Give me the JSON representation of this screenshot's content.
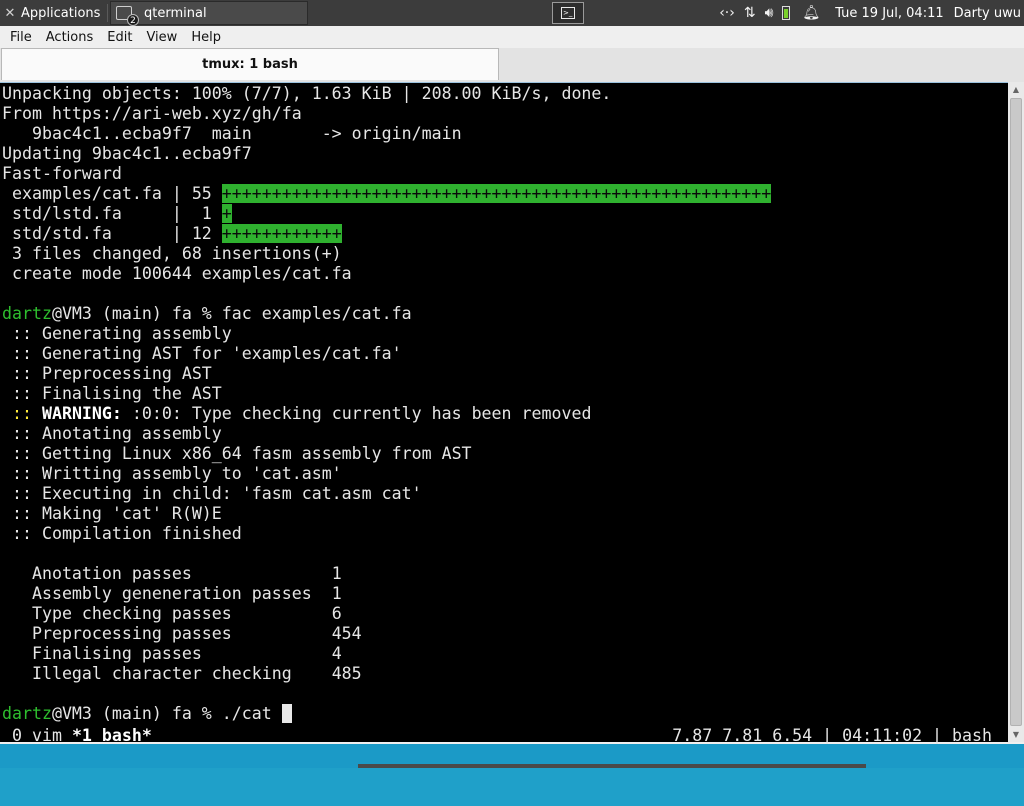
{
  "panel": {
    "applications": "Applications",
    "task_title": "qterminal",
    "task_count": "2",
    "clock": "Tue 19 Jul, 04:11",
    "user": "Darty uwu"
  },
  "menubar": {
    "file": "File",
    "actions": "Actions",
    "edit": "Edit",
    "view": "View",
    "help": "Help"
  },
  "tab": {
    "title": "tmux: 1 bash"
  },
  "terminal": {
    "l01": "Unpacking objects: 100% (7/7), 1.63 KiB | 208.00 KiB/s, done.",
    "l02": "From https://ari-web.xyz/gh/fa",
    "l03": "   9bac4c1..ecba9f7  main       -> origin/main",
    "l04": "Updating 9bac4c1..ecba9f7",
    "l05": "Fast-forward",
    "diff1_name": " examples/cat.fa | 55 ",
    "diff1_bar": "+++++++++++++++++++++++++++++++++++++++++++++++++++++++",
    "diff2_name": " std/lstd.fa     |  1 ",
    "diff2_bar": "+",
    "diff3_name": " std/std.fa      | 12 ",
    "diff3_bar": "++++++++++++",
    "l09": " 3 files changed, 68 insertions(+)",
    "l10": " create mode 100644 examples/cat.fa",
    "prompt_user": "dartz",
    "prompt1_rest": "@VM3 (main) fa % fac examples/cat.fa",
    "s1": " :: Generating assembly",
    "s2": " :: Generating AST for 'examples/cat.fa'",
    "s3": " :: Preprocessing AST",
    "s4": " :: Finalising the AST",
    "warn_prefix": " :: ",
    "warn_label": "WARNING:",
    "warn_text": " :0:0: Type checking currently has been removed",
    "s6": " :: Anotating assembly",
    "s7": " :: Getting Linux x86_64 fasm assembly from AST",
    "s8": " :: Writting assembly to 'cat.asm'",
    "s9": " :: Executing in child: 'fasm cat.asm cat'",
    "s10": " :: Making 'cat' R(W)E",
    "s11": " :: Compilation finished",
    "stats": [
      {
        "label": "   Anotation passes              ",
        "value": "1"
      },
      {
        "label": "   Assembly geneneration passes  ",
        "value": "1"
      },
      {
        "label": "   Type checking passes          ",
        "value": "6"
      },
      {
        "label": "   Preprocessing passes          ",
        "value": "454"
      },
      {
        "label": "   Finalising passes             ",
        "value": "4"
      },
      {
        "label": "   Illegal character checking    ",
        "value": "485"
      }
    ],
    "prompt2_user": "dartz",
    "prompt2_rest": "@VM3 (main) fa % ./cat "
  },
  "tmux_status": {
    "left_plain": " 0 vim ",
    "left_active": "*1 bash*",
    "right": "7.87 7.81 6.54 | 04:11:02 | bash"
  },
  "colors": {
    "prompt_user": "#2ebf2e",
    "diff_bar": "#2fb12f",
    "warning": "#ffeb3b",
    "desktop": "#1fa0c9"
  }
}
